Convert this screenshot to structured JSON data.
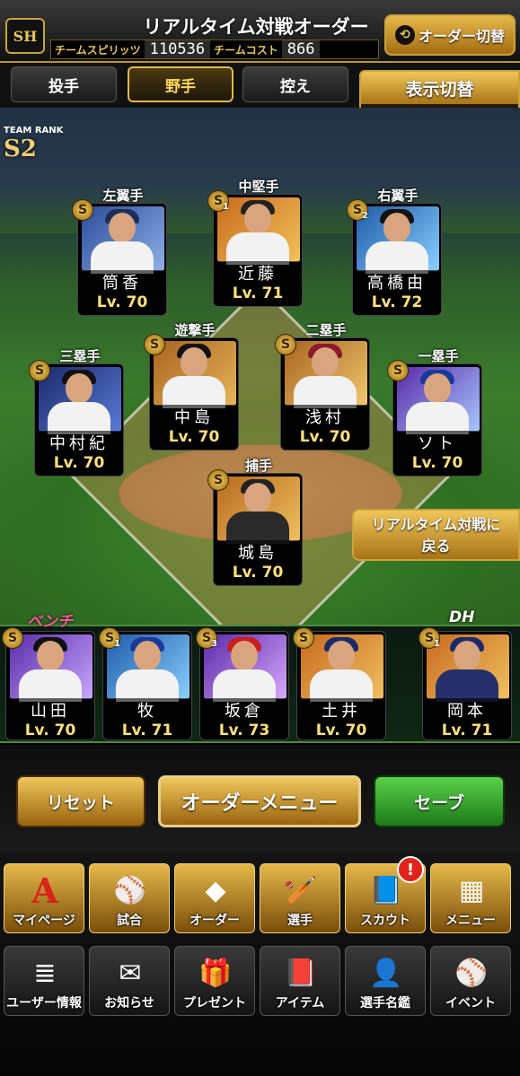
{
  "header": {
    "logo_text": "SH",
    "title": "リアルタイム対戦オーダー",
    "spirits_label": "チームスピリッツ",
    "spirits_value": "110536",
    "cost_label": "チームコスト",
    "cost_value": "866",
    "order_switch_label": "オーダー切替"
  },
  "tabs": [
    {
      "label": "投手",
      "active": false
    },
    {
      "label": "野手",
      "active": true
    },
    {
      "label": "控え",
      "active": false
    }
  ],
  "view_switch": {
    "label": "表示切替",
    "value": "ー"
  },
  "team_rank": {
    "label": "TEAM RANK",
    "value": "S2"
  },
  "lineup": [
    {
      "position": "左翼手",
      "name": "筒香",
      "level": "Lv. 70",
      "coin": "S",
      "coin_num": ""
    },
    {
      "position": "中堅手",
      "name": "近藤",
      "level": "Lv. 71",
      "coin": "S",
      "coin_num": "1"
    },
    {
      "position": "右翼手",
      "name": "高橋由",
      "level": "Lv. 72",
      "coin": "S",
      "coin_num": "2"
    },
    {
      "position": "三塁手",
      "name": "中村紀",
      "level": "Lv. 70",
      "coin": "S",
      "coin_num": ""
    },
    {
      "position": "遊撃手",
      "name": "中島",
      "level": "Lv. 70",
      "coin": "S",
      "coin_num": ""
    },
    {
      "position": "二塁手",
      "name": "浅村",
      "level": "Lv. 70",
      "coin": "S",
      "coin_num": ""
    },
    {
      "position": "一塁手",
      "name": "ソト",
      "level": "Lv. 70",
      "coin": "S",
      "coin_num": ""
    },
    {
      "position": "捕手",
      "name": "城島",
      "level": "Lv. 70",
      "coin": "S",
      "coin_num": ""
    }
  ],
  "back_button": {
    "line1": "リアルタイム対戦に",
    "line2": "戻る"
  },
  "bench": {
    "label": "ベンチ",
    "dh_label": "DH",
    "players": [
      {
        "name": "山田",
        "level": "Lv. 70",
        "coin": "S",
        "coin_num": ""
      },
      {
        "name": "牧",
        "level": "Lv. 71",
        "coin": "S",
        "coin_num": "1"
      },
      {
        "name": "坂倉",
        "level": "Lv. 73",
        "coin": "S",
        "coin_num": "3"
      },
      {
        "name": "土井",
        "level": "Lv. 70",
        "coin": "S",
        "coin_num": ""
      },
      {
        "name": "岡本",
        "level": "Lv. 71",
        "coin": "S",
        "coin_num": "1"
      }
    ]
  },
  "actions": {
    "reset": "リセット",
    "order_menu": "オーダーメニュー",
    "save": "セーブ"
  },
  "nav_row1": [
    {
      "label": "マイページ",
      "icon": "A"
    },
    {
      "label": "試合",
      "icon": "⚾"
    },
    {
      "label": "オーダー",
      "icon": "◆"
    },
    {
      "label": "選手",
      "icon": "🏏"
    },
    {
      "label": "スカウト",
      "icon": "📘"
    },
    {
      "label": "メニュー",
      "icon": "▦"
    }
  ],
  "scout_badge": "!",
  "nav_row2": [
    {
      "label": "ユーザー情報",
      "icon": "≣"
    },
    {
      "label": "お知らせ",
      "icon": "✉"
    },
    {
      "label": "プレゼント",
      "icon": "🎁"
    },
    {
      "label": "アイテム",
      "icon": "📕"
    },
    {
      "label": "選手名鑑",
      "icon": "👤"
    },
    {
      "label": "イベント",
      "icon": "⚾"
    }
  ],
  "colors": {
    "gold": "#c9a43b",
    "green_button": "#2f8f2a",
    "badge": "#e2231a"
  }
}
